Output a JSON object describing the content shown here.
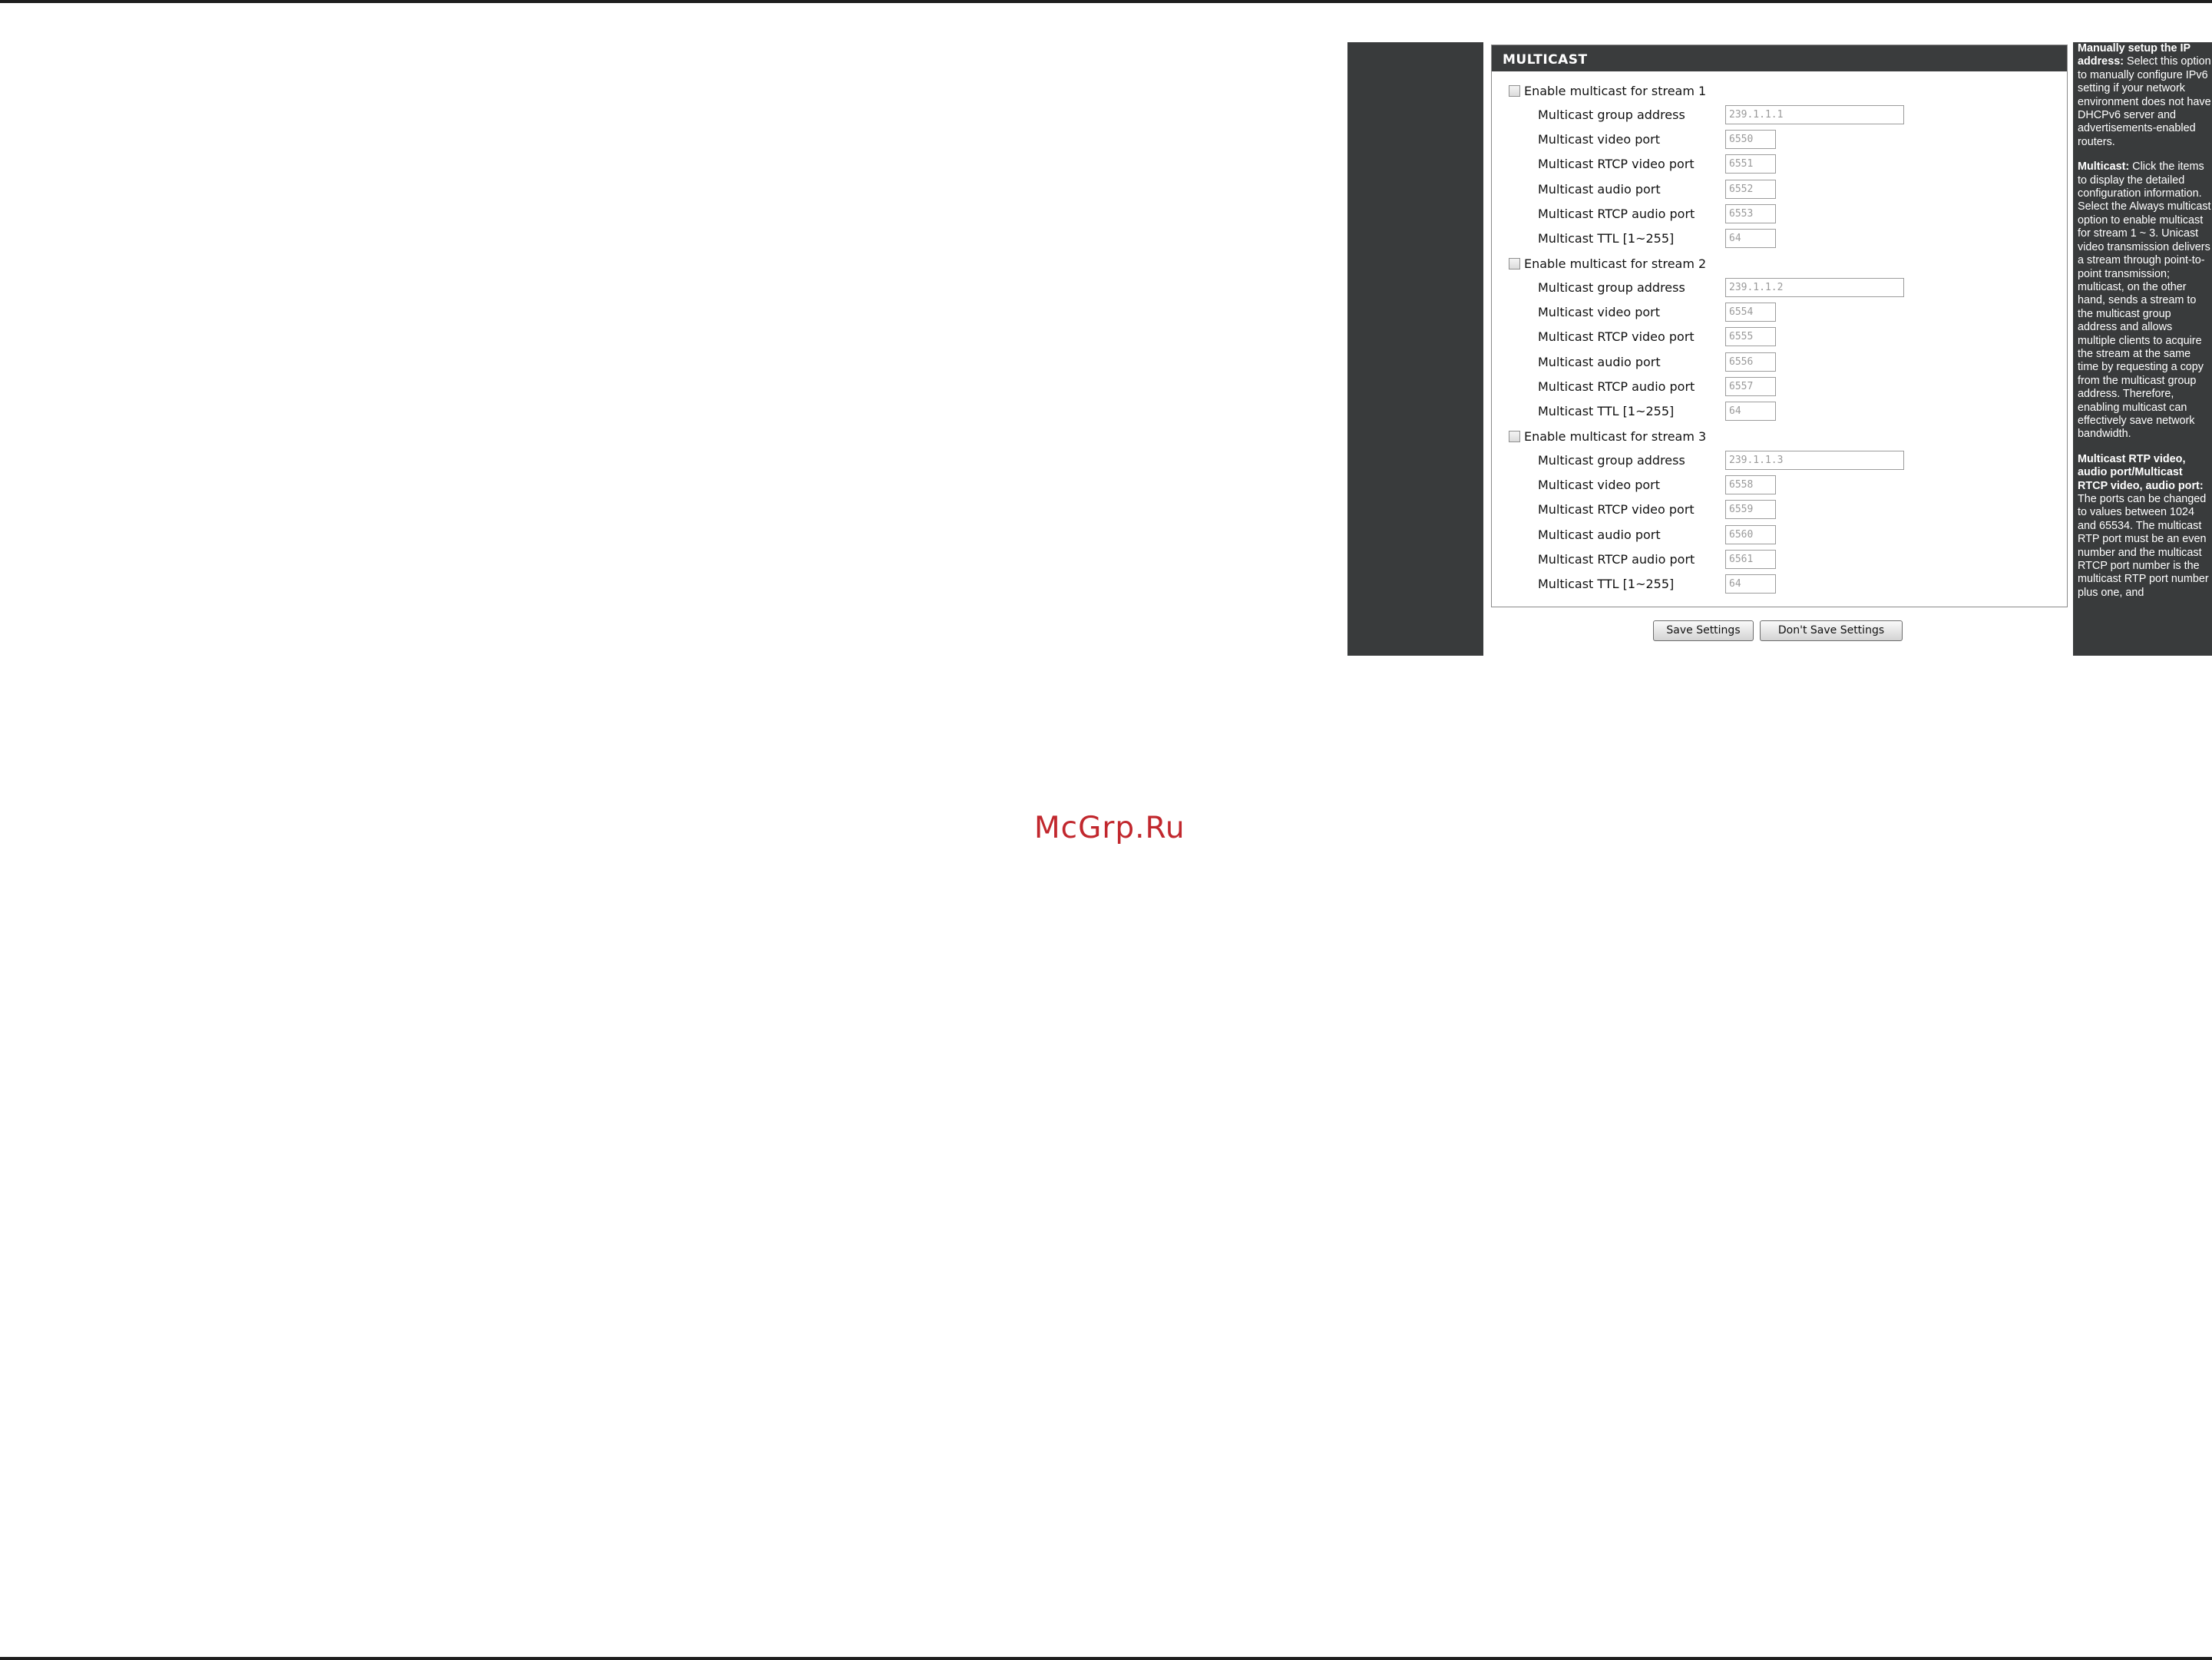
{
  "section": {
    "title": "MULTICAST"
  },
  "streams": [
    {
      "enable_label": "Enable multicast for stream 1",
      "checked": false,
      "fields": [
        {
          "label": "Multicast group address",
          "value": "239.1.1.1"
        },
        {
          "label": "Multicast video port",
          "value": "6550"
        },
        {
          "label": "Multicast RTCP video port",
          "value": "6551"
        },
        {
          "label": "Multicast audio port",
          "value": "6552"
        },
        {
          "label": "Multicast RTCP audio port",
          "value": "6553"
        },
        {
          "label": "Multicast TTL [1~255]",
          "value": "64"
        }
      ]
    },
    {
      "enable_label": "Enable multicast for stream 2",
      "checked": false,
      "fields": [
        {
          "label": "Multicast group address",
          "value": "239.1.1.2"
        },
        {
          "label": "Multicast video port",
          "value": "6554"
        },
        {
          "label": "Multicast RTCP video port",
          "value": "6555"
        },
        {
          "label": "Multicast audio port",
          "value": "6556"
        },
        {
          "label": "Multicast RTCP audio port",
          "value": "6557"
        },
        {
          "label": "Multicast TTL [1~255]",
          "value": "64"
        }
      ]
    },
    {
      "enable_label": "Enable multicast for stream 3",
      "checked": false,
      "fields": [
        {
          "label": "Multicast group address",
          "value": "239.1.1.3"
        },
        {
          "label": "Multicast video port",
          "value": "6558"
        },
        {
          "label": "Multicast RTCP video port",
          "value": "6559"
        },
        {
          "label": "Multicast audio port",
          "value": "6560"
        },
        {
          "label": "Multicast RTCP audio port",
          "value": "6561"
        },
        {
          "label": "Multicast TTL [1~255]",
          "value": "64"
        }
      ]
    }
  ],
  "buttons": {
    "save": "Save Settings",
    "dont_save": "Don't Save Settings"
  },
  "help": {
    "p1_title": "Manually setup the IP address:",
    "p1_text": " Select this option to manually configure IPv6 setting if your network environment does not have DHCPv6 server and advertisements-enabled routers.",
    "p2_title": "Multicast:",
    "p2_text": " Click the items to display the detailed configuration information. Select the Always multicast option to enable multicast for stream 1 ~ 3. Unicast video transmission delivers a stream through point-to-point transmission; multicast, on the other hand, sends a stream to the multicast group address and allows multiple clients to acquire the stream at the same time by requesting a copy from the multicast group address. Therefore, enabling multicast can effectively save network bandwidth.",
    "p3_title": "Multicast RTP video, audio port/Multicast RTCP video, audio port:",
    "p3_text": " The ports can be changed to values between 1024 and 65534. The multicast RTP port must be an even number and the multicast RTCP port number is the multicast RTP port number plus one, and"
  },
  "watermark": "McGrp.Ru"
}
